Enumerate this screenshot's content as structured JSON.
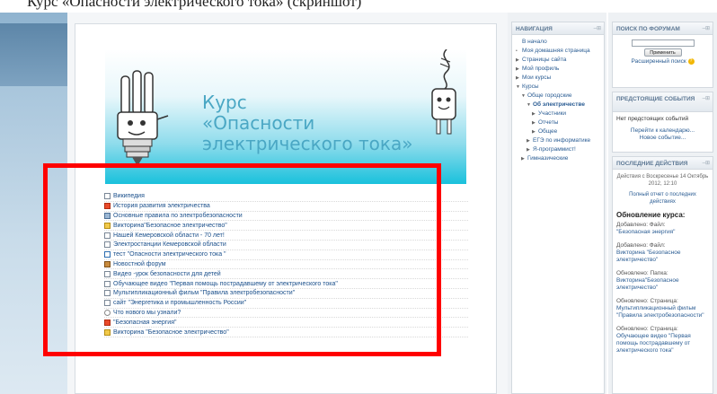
{
  "caption_fragment": "Курс «Опасности электрического тока» (скриншот)",
  "banner": {
    "title_lines": [
      "Курс",
      "«Опасности",
      "электрического тока»"
    ]
  },
  "resources": [
    {
      "label": "Википедия",
      "icon": "page"
    },
    {
      "label": "История развития электричества",
      "icon": "red"
    },
    {
      "label": "Основные правила по электробезопасности",
      "icon": "folder"
    },
    {
      "label": "Викторина\"Безопасное электричество\"",
      "icon": "quiz"
    },
    {
      "label": "Нашей Кемеровской области - 70 лет!",
      "icon": "page"
    },
    {
      "label": "Электростанции Кемеровской области",
      "icon": "page"
    },
    {
      "label": "тест \"Опасности электрического тока \"",
      "icon": "check"
    },
    {
      "label": "Новостной форум",
      "icon": "forum"
    },
    {
      "label": "Видео -урок безопасности для детей",
      "icon": "page"
    },
    {
      "label": "Обучающее видео \"Первая помощь пострадавшему от электрического тока\"",
      "icon": "page"
    },
    {
      "label": "Мультипликационный фильм \"Правила электробезопасности\"",
      "icon": "page"
    },
    {
      "label": "сайт \"Энергетика и промышленность России\"",
      "icon": "page"
    },
    {
      "label": "Что нового мы узнали?",
      "icon": "chat"
    },
    {
      "label": "\"Безопасная энергия\"",
      "icon": "red"
    },
    {
      "label": "Викторина \"Безопасное электричество\"",
      "icon": "quiz"
    }
  ],
  "navigation": {
    "header": "НАВИГАЦИЯ",
    "items": [
      {
        "label": "В начало",
        "bullet": "",
        "indent": 0,
        "bold": false
      },
      {
        "label": "Моя домашняя страница",
        "bullet": "•",
        "indent": 0,
        "bold": false
      },
      {
        "label": "Страницы сайта",
        "bullet": "▶",
        "indent": 0,
        "bold": false
      },
      {
        "label": "Мой профиль",
        "bullet": "▶",
        "indent": 0,
        "bold": false
      },
      {
        "label": "Мои курсы",
        "bullet": "▶",
        "indent": 0,
        "bold": false
      },
      {
        "label": "Курсы",
        "bullet": "▼",
        "indent": 0,
        "bold": false
      },
      {
        "label": "Обще городские",
        "bullet": "▼",
        "indent": 1,
        "bold": false
      },
      {
        "label": "Об электричестве",
        "bullet": "▼",
        "indent": 2,
        "bold": true
      },
      {
        "label": "Участники",
        "bullet": "▶",
        "indent": 3,
        "bold": false
      },
      {
        "label": "Отчеты",
        "bullet": "▶",
        "indent": 3,
        "bold": false
      },
      {
        "label": "Общее",
        "bullet": "▶",
        "indent": 3,
        "bold": false
      },
      {
        "label": "ЕГЭ по информатике",
        "bullet": "▶",
        "indent": 2,
        "bold": false
      },
      {
        "label": "Я-программист!",
        "bullet": "▶",
        "indent": 2,
        "bold": false
      },
      {
        "label": "Гимназические",
        "bullet": "▶",
        "indent": 1,
        "bold": false
      }
    ]
  },
  "search": {
    "header": "ПОИСК ПО ФОРУМАМ",
    "button": "Применить",
    "advanced": "Расширенный поиск"
  },
  "events": {
    "header": "ПРЕДСТОЯЩИЕ СОБЫТИЯ",
    "none": "Нет предстоящих событий",
    "calendar_link": "Перейти к календарю...",
    "new_event_link": "Новое событие..."
  },
  "activity": {
    "header": "ПОСЛЕДНИЕ ДЕЙСТВИЯ",
    "since": "Действия с Воскресенье 14 Октябрь 2012, 12:10",
    "full_report": "Полный отчет о последних действиях",
    "updates_title": "Обновление курса:",
    "updates": [
      {
        "kind": "Добавлено: Файл:",
        "name": "\"Безопасная энергия\""
      },
      {
        "kind": "Добавлено: Файл:",
        "name": "Викторина \"Безопасное электричество\""
      },
      {
        "kind": "Обновлено: Папка:",
        "name": "Викторина\"Безопасное электричество\""
      },
      {
        "kind": "Обновлено: Страница:",
        "name": "Мультипликационный фильм \"Правила электробезопасности\""
      },
      {
        "kind": "Обновлено: Страница:",
        "name": "Обучающее видео \"Первая помощь пострадавшему от электрического тока\""
      }
    ]
  },
  "block_control_glyph": "–⊞",
  "help_glyph": "?"
}
